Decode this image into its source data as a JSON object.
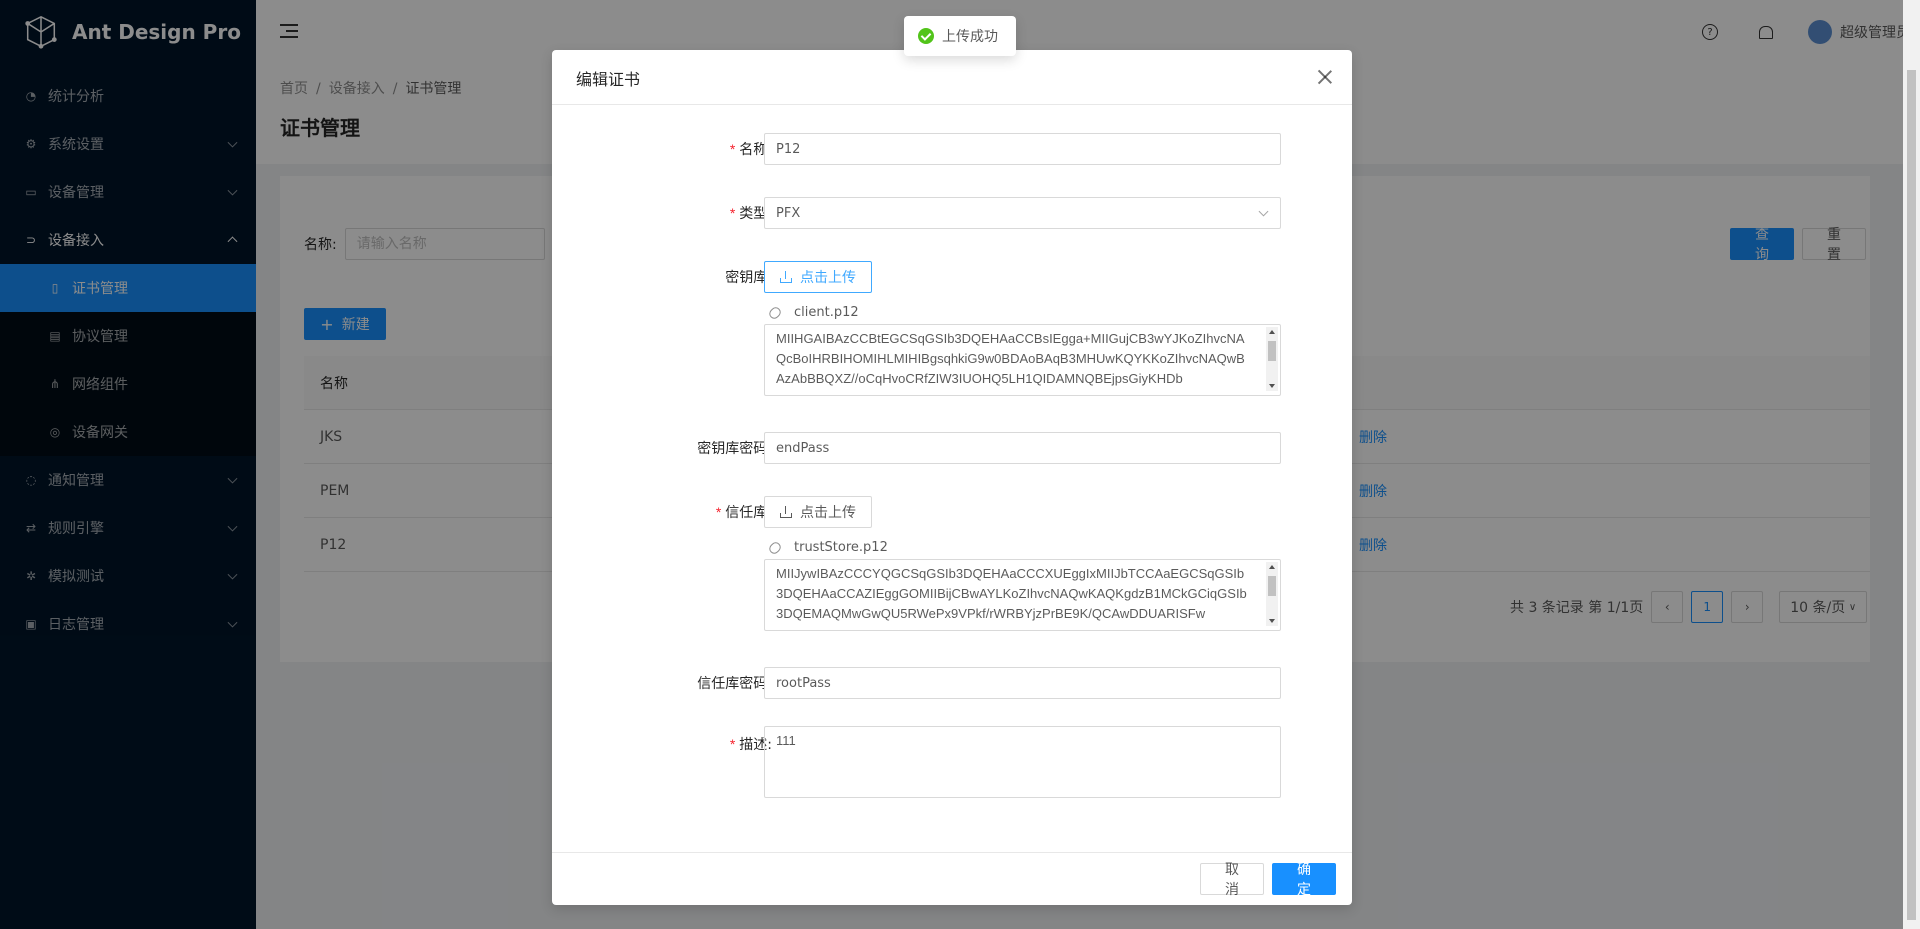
{
  "app": {
    "title": "Ant Design Pro"
  },
  "colors": {
    "primary": "#1890ff",
    "sider": "#001529",
    "success": "#52c41a",
    "required": "#f5222d"
  },
  "sidebar": {
    "items": [
      {
        "label": "统计分析",
        "icon": "dashboard-icon"
      },
      {
        "label": "系统设置",
        "icon": "gear-icon"
      },
      {
        "label": "设备管理",
        "icon": "device-icon"
      },
      {
        "label": "设备接入",
        "icon": "link-icon"
      },
      {
        "label": "通知管理",
        "icon": "message-icon"
      },
      {
        "label": "规则引擎",
        "icon": "swap-icon"
      },
      {
        "label": "模拟测试",
        "icon": "bug-icon"
      },
      {
        "label": "日志管理",
        "icon": "calendar-icon"
      }
    ],
    "sub_items": [
      {
        "label": "证书管理",
        "icon": "file-icon"
      },
      {
        "label": "协议管理",
        "icon": "book-icon"
      },
      {
        "label": "网络组件",
        "icon": "network-icon"
      },
      {
        "label": "设备网关",
        "icon": "gateway-icon"
      }
    ]
  },
  "header": {
    "username": "超级管理员"
  },
  "breadcrumb": [
    "首页",
    "设备接入",
    "证书管理"
  ],
  "page": {
    "title": "证书管理"
  },
  "search": {
    "label": "名称:",
    "placeholder": "请输入名称",
    "query_label": "查 询",
    "reset_label": "重 置"
  },
  "table": {
    "new_label": "新建",
    "header_name": "名称",
    "rows": [
      {
        "name": "JKS",
        "action": "删除"
      },
      {
        "name": "PEM",
        "action": "删除"
      },
      {
        "name": "P12",
        "action": "删除"
      }
    ]
  },
  "pagination": {
    "summary": "共 3 条记录 第 1/1页",
    "current": "1",
    "page_size": "10 条/页"
  },
  "toast": {
    "text": "上传成功"
  },
  "modal": {
    "title": "编辑证书",
    "fields": {
      "name": {
        "label": "名称",
        "value": "P12"
      },
      "type": {
        "label": "类型",
        "value": "PFX"
      },
      "keystore": {
        "label": "密钥库",
        "upload_label": "点击上传",
        "file_name": "client.p12",
        "content": "MIIHGAIBAzCCBtEGCSqGSIb3DQEHAaCCBsIEgga+MIIGujCB3wYJKoZIhvcNAQcBoIHRBIHOMIHLMIHIBgsqhkiG9w0BDAoBAqB3MHUwKQYKKoZIhvcNAQwBAzAbBBQXZ//oCqHvoCRfZIW3IUOHQ5LH1QIDAMNQBEjpsGiyKHDb"
      },
      "keystore_password": {
        "label": "密钥库密码",
        "value": "endPass"
      },
      "truststore": {
        "label": "信任库",
        "upload_label": "点击上传",
        "file_name": "trustStore.p12",
        "content": "MIIJywIBAzCCCYQGCSqGSIb3DQEHAaCCCXUEggIxMIIJbTCCAaEGCSqGSIb3DQEHAaCCAZIEggGOMIIBijCBwAYLKoZIhvcNAQwKAQKgdzB1MCkGCiqGSIb3DQEMAQMwGwQU5RWePx9VPkf/rWRBYjzPrBE9K/QCAwDDUARISFw"
      },
      "truststore_password": {
        "label": "信任库密码",
        "value": "rootPass"
      },
      "description": {
        "label": "描述",
        "value": "111"
      }
    },
    "cancel_label": "取 消",
    "ok_label": "确 定"
  }
}
